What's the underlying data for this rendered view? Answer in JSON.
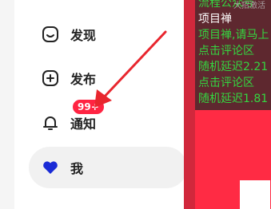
{
  "nav": {
    "items": [
      {
        "label": "发现",
        "icon": "discover-icon"
      },
      {
        "label": "发布",
        "icon": "publish-icon"
      },
      {
        "label": "通知",
        "icon": "bell-icon",
        "badge": "99+"
      },
      {
        "label": "我",
        "icon": "heart-avatar-icon"
      }
    ]
  },
  "overlay": {
    "lines": [
      "流程公众号",
      "项目禅",
      "项目禅,请马上",
      "点击评论区",
      "随机延迟2.21",
      "点击评论区",
      "随机延迟1.81"
    ],
    "ghost_text": "大招激活"
  },
  "colors": {
    "accent": "#ff2442",
    "overlay_text": "#34d640",
    "arrow": "#e8262e",
    "heart": "#1a2bd6"
  }
}
